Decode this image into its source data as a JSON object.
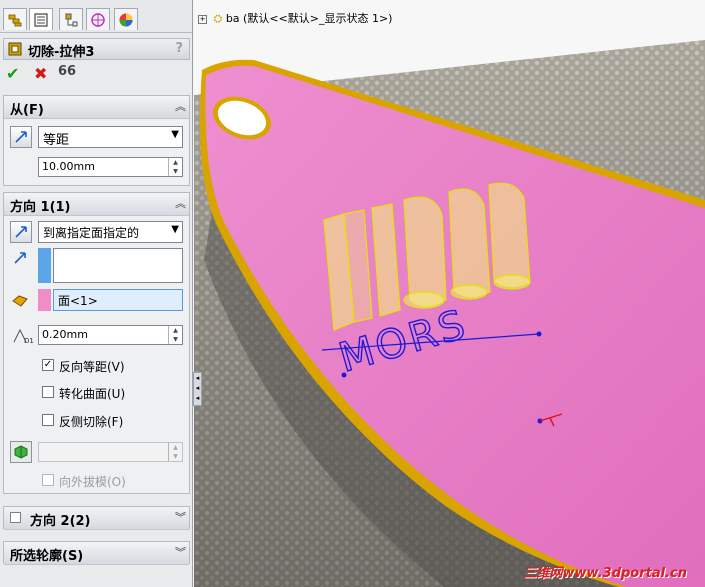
{
  "tabs": [
    {
      "name": "feature-manager-tab-icon"
    },
    {
      "name": "property-manager-tab-icon"
    },
    {
      "name": "configuration-manager-tab-icon"
    },
    {
      "name": "dimxpert-tab-icon"
    },
    {
      "name": "display-manager-tab-icon"
    }
  ],
  "feature": {
    "title": "切除-拉伸3",
    "help": "?",
    "ok_glyph": "✔",
    "cancel_glyph": "✖",
    "preview_glyph": "66"
  },
  "from": {
    "header": "从(F)",
    "type_value": "等距",
    "offset_value": "10.00mm"
  },
  "direction1": {
    "header": "方向 1(1)",
    "end_condition": "到离指定面指定的",
    "face_value": "面<1>",
    "offset_value": "0.20mm",
    "reverse_offset_label": "反向等距(V)",
    "reverse_offset_checked": true,
    "translate_surface_label": "转化曲面(U)",
    "translate_surface_checked": false,
    "flip_side_label": "反侧切除(F)",
    "flip_side_checked": false,
    "draft_outward_label": "向外拔模(O)",
    "check_glyph": "✓"
  },
  "direction2": {
    "header": "方向 2(2)"
  },
  "contours": {
    "header": "所选轮廓(S)"
  },
  "viewport": {
    "tree_plus": "+",
    "tree_text": "ba  (默认<<默认>_显示状态 1>)",
    "model_text": "MORS",
    "watermark": "三维网www.3dportal.cn"
  },
  "colors": {
    "skateboard": "#e879c6",
    "edge": "#e0b000",
    "extrude_preview": "#f4f27a",
    "sketch_text": "#1a1ad8",
    "group_accent": "#5aa6e8",
    "face_accent": "#f08cc8"
  }
}
